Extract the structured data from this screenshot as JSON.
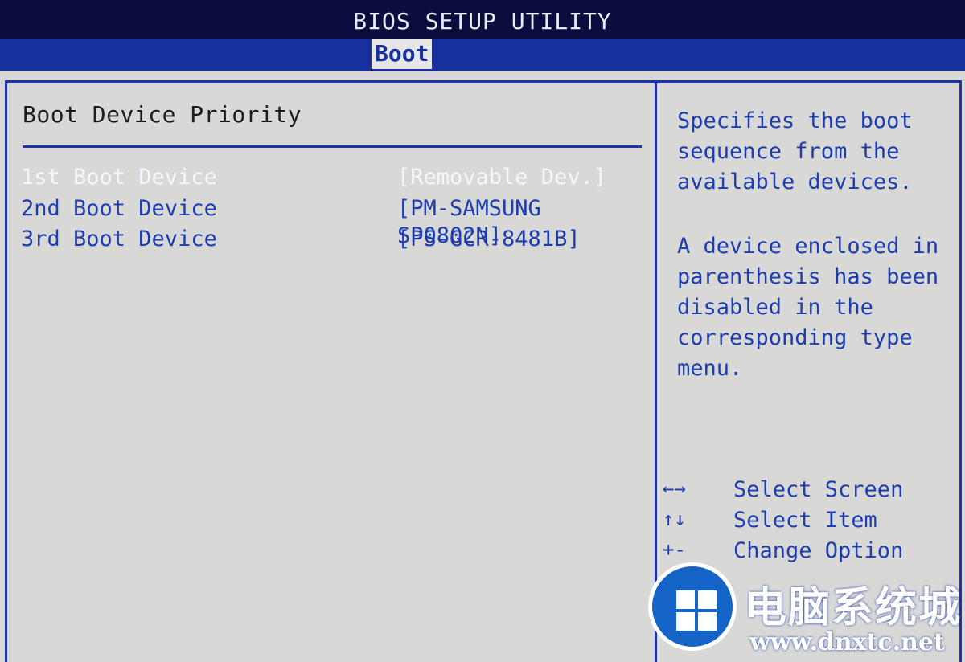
{
  "header": {
    "title": "BIOS SETUP UTILITY",
    "active_tab": "Boot"
  },
  "main": {
    "section_title": "Boot Device Priority",
    "rows": [
      {
        "label": "1st Boot Device",
        "value": "[Removable Dev.]",
        "selected": true
      },
      {
        "label": "2nd Boot Device",
        "value": "[PM-SAMSUNG SP0802N]",
        "selected": false
      },
      {
        "label": "3rd Boot Device",
        "value": "[PS-GCR-8481B]",
        "selected": false
      }
    ]
  },
  "help": {
    "paragraph1": [
      "Specifies the boot",
      "sequence from the",
      "available devices."
    ],
    "paragraph2": [
      "A device enclosed in",
      "parenthesis has been",
      "disabled in the",
      "corresponding type",
      "menu."
    ]
  },
  "keys": [
    {
      "key": "←→",
      "desc": "Select Screen"
    },
    {
      "key": "↑↓",
      "desc": "Select Item"
    },
    {
      "key": "+-",
      "desc": "Change Option"
    }
  ],
  "watermark": {
    "name": "电脑系统城",
    "url": "www.dnxtc.net",
    "icon": "windows-logo-icon"
  },
  "colors": {
    "background": "#d8d9d7",
    "accent": "#1d34a8",
    "text_blue": "#1d3cb0",
    "selected_text": "#f4f6fb"
  }
}
